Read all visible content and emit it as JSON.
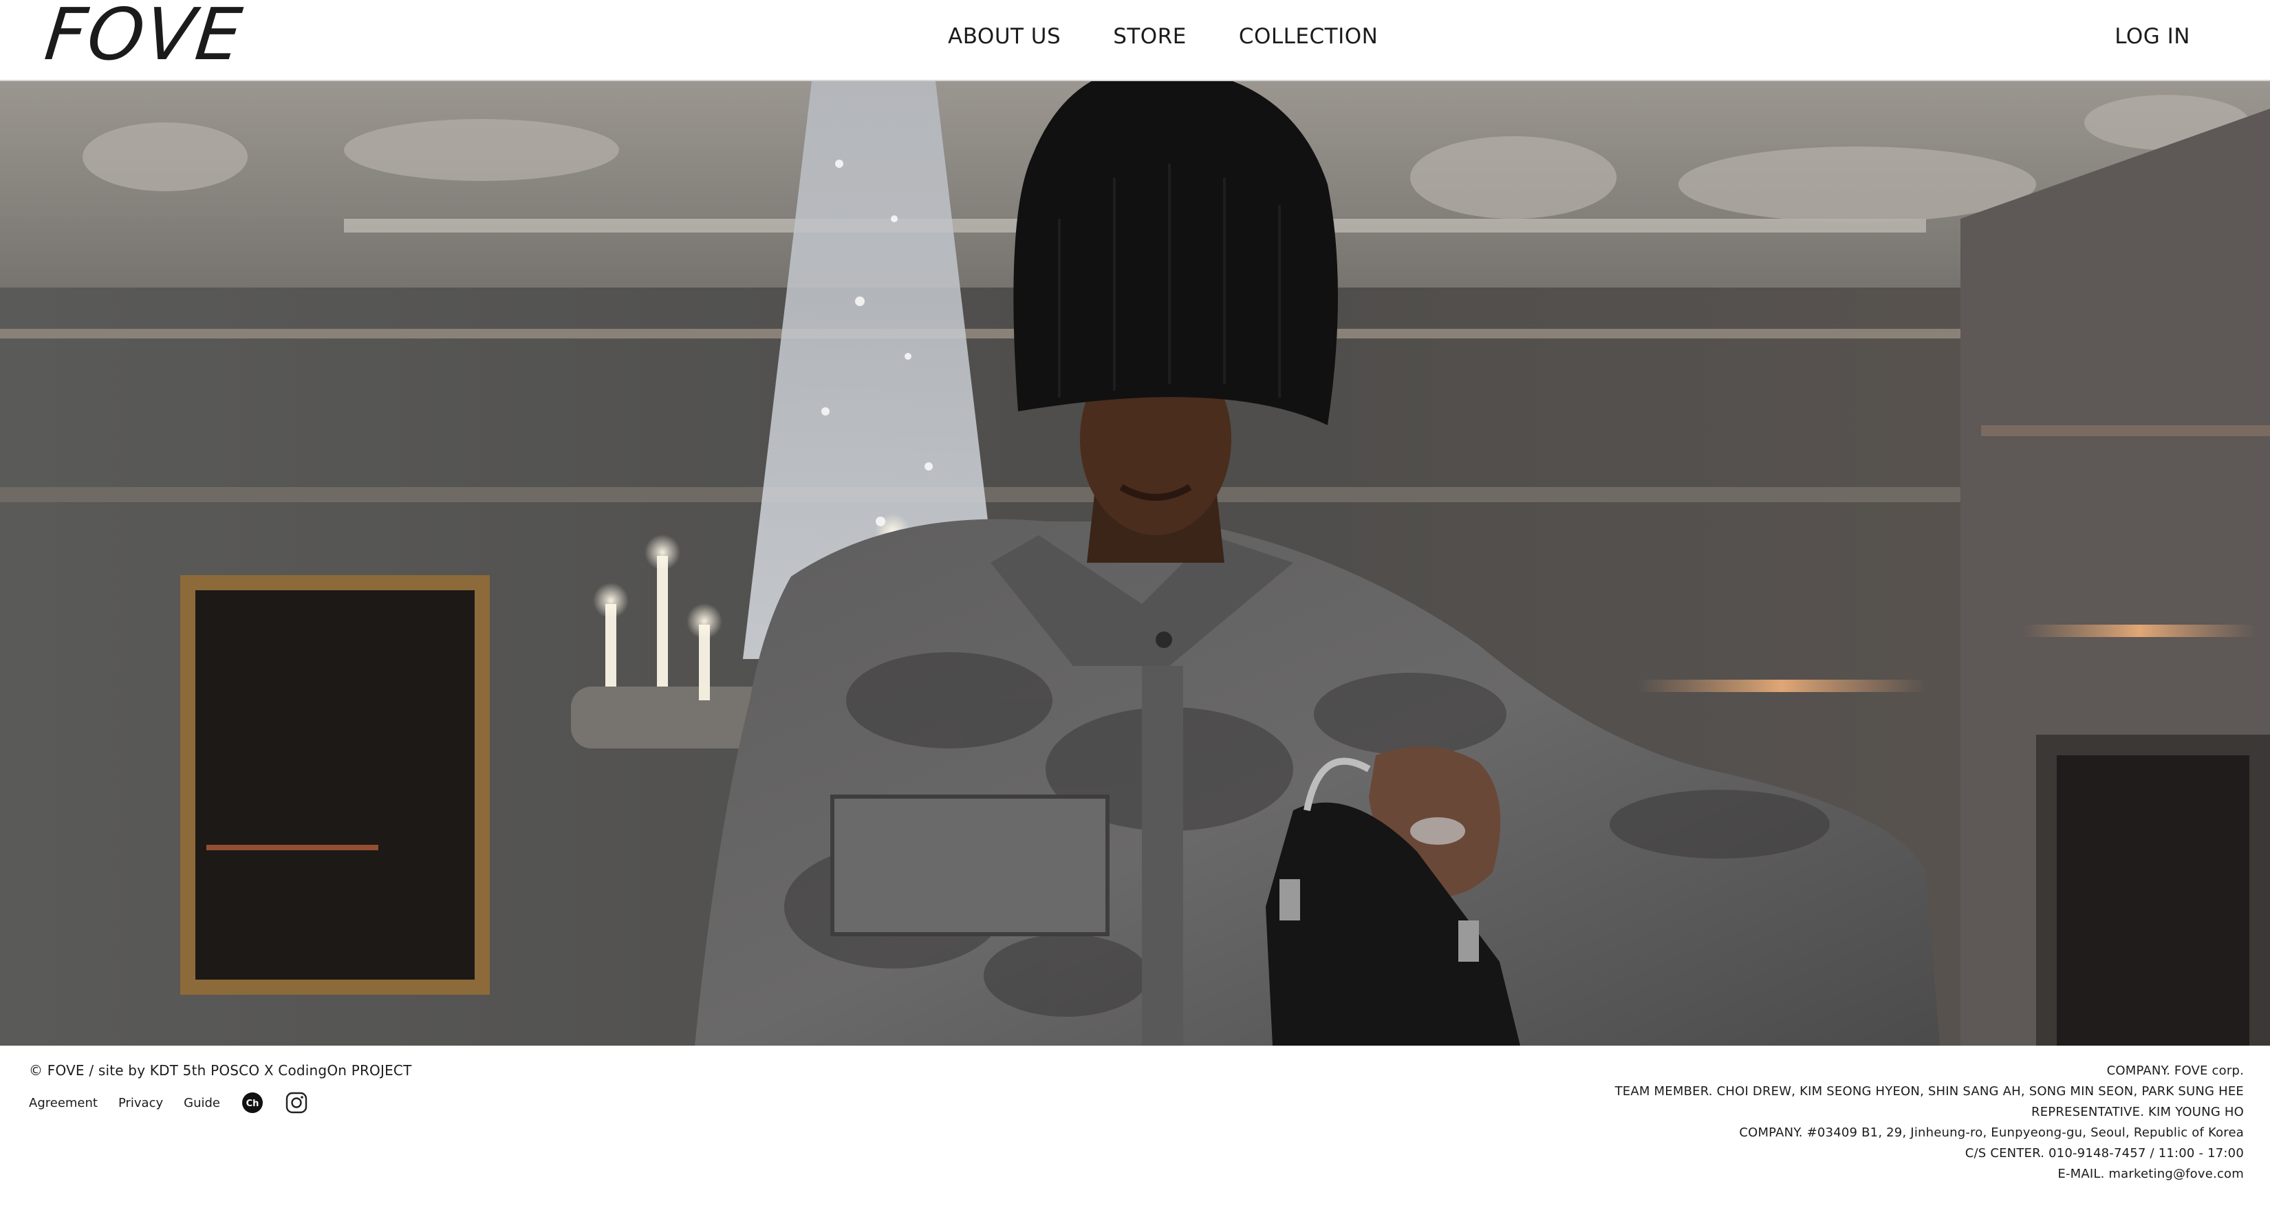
{
  "header": {
    "logo": "FOVE",
    "nav": [
      {
        "label": "ABOUT US"
      },
      {
        "label": "STORE"
      },
      {
        "label": "COLLECTION"
      }
    ],
    "login_label": "LOG IN"
  },
  "hero": {
    "media": "video-still",
    "description": "person-in-beanie-and-camo-jacket-holding-bag"
  },
  "footer": {
    "copyright": "© FOVE / site by KDT 5th POSCO X CodingOn PROJECT",
    "links": [
      {
        "label": "Agreement"
      },
      {
        "label": "Privacy"
      },
      {
        "label": "Guide"
      }
    ],
    "sns": [
      {
        "icon": "kakao-channel-icon",
        "glyph": "Ch"
      },
      {
        "icon": "instagram-icon"
      }
    ],
    "company_info": [
      "COMPANY. FOVE corp.",
      "TEAM MEMBER. CHOI DREW, KIM SEONG HYEON, SHIN SANG AH, SONG MIN SEON, PARK SUNG HEE",
      "REPRESENTATIVE. KIM YOUNG HO",
      "COMPANY. #03409 B1, 29, Jinheung-ro, Eunpyeong-gu, Seoul, Republic of Korea",
      "C/S CENTER. 010-9148-7457 / 11:00 - 17:00",
      "E-MAIL. marketing@fove.com"
    ]
  }
}
